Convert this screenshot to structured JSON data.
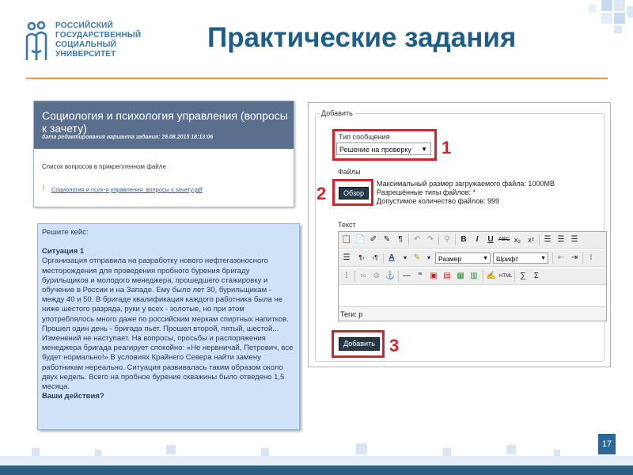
{
  "logo": {
    "text": "РОССИЙСКИЙ\nГОСУДАРСТВЕННЫЙ\nСОЦИАЛЬНЫЙ\nУНИВЕРСИТЕТ"
  },
  "slide": {
    "title": "Практические задания",
    "page_number": "17"
  },
  "course_card": {
    "title": "Социология и психология управления (вопросы к зачету)",
    "edit_date": "дата редактирования варианта задания: 26.08.2015 18:13:06",
    "text": "Список вопросов в прикрепленном файле",
    "file_link": "Социология и псих-я управления_вопросы к зачету.pdf"
  },
  "case_box": {
    "intro": "Решите кейс:",
    "heading": "Ситуация 1",
    "paragraph1": "Организация отправила на разработку нового нефтегазоносного месторождения для проведения пробного бурения бригаду бурильщиков и молодого менеджера, прошедшего стажировку и обучение в России и на Западе. Ему было лет 30, бурильщикам - между 40 и 50. В бригаде квалификация каждого работника была не ниже шестого разряда, руки у всех - золотые, но при этом употреблялось много даже по российским меркам спиртных напитков.",
    "paragraph2": "Прошел один день - бригада пьет. Прошел второй, пятый, шестой... Изменений не наступает. На вопросы, просьбы и распоряжения менеджера бригада реагирует спокойно: «Не нервничай, Петрович, все будет нормально!» В условиях Крайнего Севера найти замену работникам нереально. Ситуация развивалась таким образом около двух недель. Всего на пробное бурение скважины было отведено 1,5 месяца.",
    "question": "Ваши действия?"
  },
  "form": {
    "legend": "Добавить",
    "message_type_label": "Тип сообщения",
    "message_type_value": "Решение на проверку",
    "files_label": "Файлы",
    "browse_label": "Обзор",
    "file_info": [
      "Максимальный размер загружаемого файла: 1000MB",
      "Разрешённые типы файлов: *",
      "Допустимое количество файлов: 999"
    ],
    "text_label": "Текст",
    "size_select": "Размер",
    "font_select": "Шрифт",
    "tags_label": "Теги: p",
    "submit_label": "Добавить"
  },
  "callouts": {
    "n1": "1",
    "n2": "2",
    "n3": "3"
  },
  "colors": {
    "title": "#1f5e86",
    "accent_line": "#e39a4e",
    "callout_red": "#d6222b",
    "card_header": "#5a6f8e",
    "case_bg": "#cfe2f8"
  }
}
